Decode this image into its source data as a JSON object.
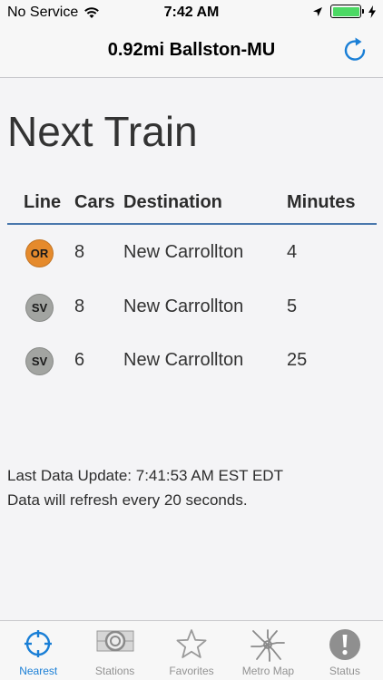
{
  "status_bar": {
    "carrier": "No Service",
    "time": "7:42 AM"
  },
  "nav": {
    "title": "0.92mi Ballston-MU",
    "refresh_icon": "refresh-icon"
  },
  "page": {
    "heading": "Next Train",
    "columns": [
      "Line",
      "Cars",
      "Destination",
      "Minutes"
    ],
    "rows": [
      {
        "line": "OR",
        "line_color": "#e58a2c",
        "cars": "8",
        "destination": "New Carrollton",
        "minutes": "4"
      },
      {
        "line": "SV",
        "line_color": "#a2a4a1",
        "cars": "8",
        "destination": "New Carrollton",
        "minutes": "5"
      },
      {
        "line": "SV",
        "line_color": "#a2a4a1",
        "cars": "6",
        "destination": "New Carrollton",
        "minutes": "25"
      }
    ],
    "last_update": "Last Data Update: 7:41:53 AM EST EDT",
    "refresh_note": "Data will refresh every 20 seconds."
  },
  "tabs": [
    {
      "label": "Nearest",
      "icon": "crosshair-icon",
      "active": true
    },
    {
      "label": "Stations",
      "icon": "station-icon",
      "active": false
    },
    {
      "label": "Favorites",
      "icon": "star-icon",
      "active": false
    },
    {
      "label": "Metro Map",
      "icon": "map-icon",
      "active": false
    },
    {
      "label": "Status",
      "icon": "alert-icon",
      "active": false
    }
  ],
  "colors": {
    "accent": "#1a7fd6",
    "header_rule": "#4a78ad",
    "battery": "#4cd964"
  }
}
